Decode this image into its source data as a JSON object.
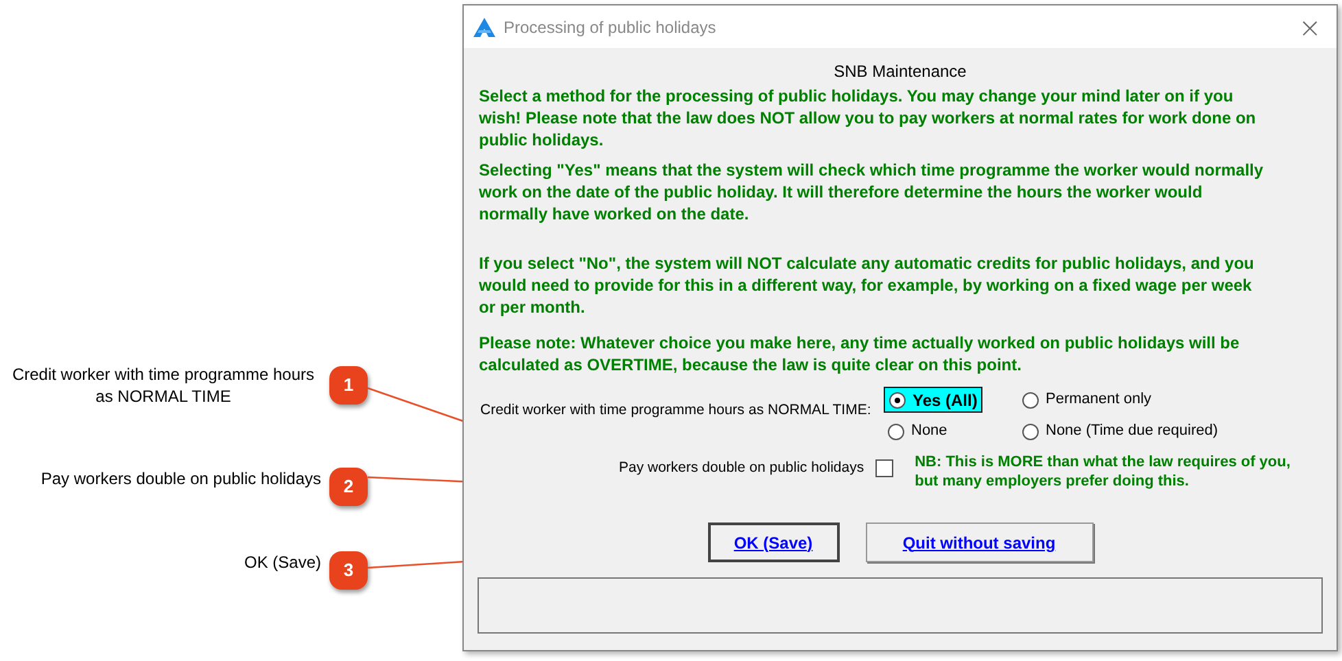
{
  "callouts": [
    {
      "number": "1",
      "label": "Credit worker with time programme hours as NORMAL TIME"
    },
    {
      "number": "2",
      "label": "Pay workers double on public holidays"
    },
    {
      "number": "3",
      "label": "OK (Save)"
    }
  ],
  "window": {
    "title": "Processing of public holidays",
    "close": "×"
  },
  "heading": "SNB Maintenance",
  "paragraphs": [
    "Select a method for the processing of public holidays. You may change your mind later on if you wish! Please note that the law does NOT allow you to pay workers at normal rates for work done on public holidays.",
    "Selecting \"Yes\" means that the system will check which time programme the worker would normally work on the date of the public holiday. It will therefore determine the hours the worker would normally have worked on the date.",
    "If you select \"No\", the system will NOT calculate any automatic credits for public holidays, and you would need to provide for this in a different way, for example, by working on a fixed wage per week or per month.",
    "Please note: Whatever choice you make here, any time actually worked on public holidays will be calculated as OVERTIME, because the law is quite clear on this point."
  ],
  "credit_option": {
    "label": "Credit worker with time programme hours as NORMAL TIME:",
    "options": [
      {
        "label": "Yes (All)",
        "selected": true
      },
      {
        "label": "Permanent only",
        "selected": false
      },
      {
        "label": "None",
        "selected": false
      },
      {
        "label": "None (Time due required)",
        "selected": false
      }
    ]
  },
  "double_pay": {
    "label": "Pay workers double on public holidays",
    "checked": false,
    "note": "NB: This is MORE than what the law requires of you, but many employers prefer doing this."
  },
  "buttons": [
    {
      "label": "OK (Save)",
      "focused": true
    },
    {
      "label": "Quit without saving",
      "focused": false
    }
  ]
}
